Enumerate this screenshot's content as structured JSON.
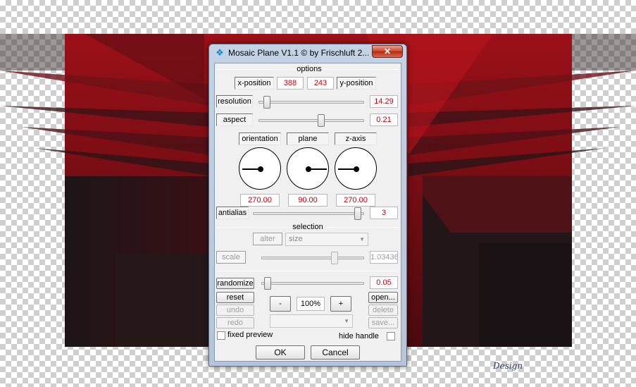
{
  "window": {
    "title": "Mosaic Plane V1.1 © by Frischluft 2...",
    "close_glyph": "✕",
    "icon": "butterfly-icon"
  },
  "options": {
    "header": "options",
    "x_position": {
      "label": "x-position",
      "value": "388"
    },
    "y_position": {
      "label": "y-position",
      "value": "243"
    },
    "resolution": {
      "label": "resolution",
      "value": "14.29",
      "slider_fraction": 0.05
    },
    "aspect": {
      "label": "aspect",
      "value": "0.21",
      "slider_fraction": 0.6
    },
    "dials": [
      {
        "label": "orientation",
        "value": "270.00"
      },
      {
        "label": "plane",
        "value": "90.00"
      },
      {
        "label": "z-axis",
        "value": "270.00"
      }
    ],
    "antialias": {
      "label": "antialias",
      "value": "3",
      "slider_fraction": 0.97
    }
  },
  "selection": {
    "header": "selection",
    "alter_label": "alter",
    "mode_value": "size",
    "scale": {
      "label": "scale",
      "value": "1.03436",
      "slider_fraction": 0.73
    }
  },
  "controls": {
    "randomize": {
      "label": "randomize",
      "value": "0.05",
      "slider_fraction": 0.03
    },
    "reset_label": "reset",
    "undo_label": "undo",
    "redo_label": "redo",
    "zoom_minus": "-",
    "zoom_value": "100%",
    "zoom_plus": "+",
    "open_label": "open...",
    "delete_label": "delete",
    "save_label": "save...",
    "fixed_preview_label": "fixed preview",
    "hide_handle_label": "hide handle"
  },
  "footer": {
    "ok_label": "OK",
    "cancel_label": "Cancel"
  },
  "watermark": {
    "text": "Design"
  },
  "colors": {
    "value_red": "#c8000a",
    "canvas_dark_red": "#8a0f16",
    "canvas_black": "#1a1416"
  }
}
